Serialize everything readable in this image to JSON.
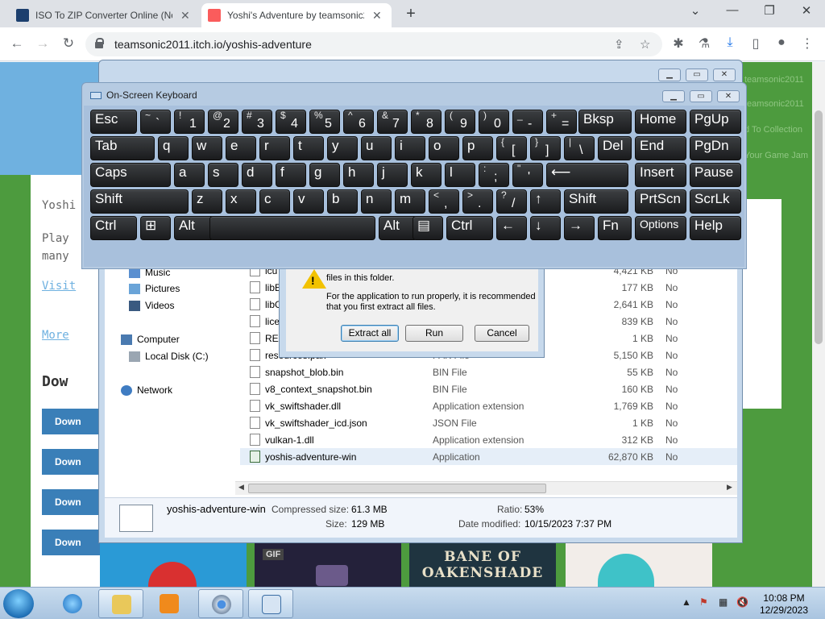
{
  "browser": {
    "tabs": [
      {
        "title": "ISO To ZIP Converter Online (No",
        "favicon": "ezyzip-icon",
        "active": false
      },
      {
        "title": "Yoshi's Adventure by teamsonic2",
        "favicon": "itchio-icon",
        "active": true
      }
    ],
    "url": "teamsonic2011.itch.io/yoshis-adventure"
  },
  "webpage": {
    "text_lines": [
      "Yoshi",
      "Play",
      "many",
      "Visit",
      "More",
      "Dow"
    ],
    "download_labels": [
      "Down",
      "Down",
      "Down",
      "Down"
    ],
    "right_links": [
      "teamsonic2011",
      "teamsonic2011",
      "d To Collection",
      "Your Game Jam"
    ],
    "gif_badge": "GIF",
    "thumb_text_1": "BANE OF",
    "thumb_text_2": "OAKENSHADE"
  },
  "osk": {
    "title": "On-Screen Keyboard",
    "rows": [
      [
        {
          "main": "Esc"
        },
        {
          "shift": "~",
          "main": "`"
        },
        {
          "shift": "!",
          "main": "1"
        },
        {
          "shift": "@",
          "main": "2"
        },
        {
          "shift": "#",
          "main": "3"
        },
        {
          "shift": "$",
          "main": "4"
        },
        {
          "shift": "%",
          "main": "5"
        },
        {
          "shift": "^",
          "main": "6"
        },
        {
          "shift": "&",
          "main": "7"
        },
        {
          "shift": "*",
          "main": "8"
        },
        {
          "shift": "(",
          "main": "9"
        },
        {
          "shift": ")",
          "main": "0"
        },
        {
          "shift": "_",
          "main": "-"
        },
        {
          "shift": "+",
          "main": "="
        },
        {
          "main": "Bksp"
        },
        {
          "main": "Home"
        },
        {
          "main": "PgUp"
        }
      ],
      [
        {
          "main": "Tab"
        },
        {
          "main": "q"
        },
        {
          "main": "w"
        },
        {
          "main": "e"
        },
        {
          "main": "r"
        },
        {
          "main": "t"
        },
        {
          "main": "y"
        },
        {
          "main": "u"
        },
        {
          "main": "i"
        },
        {
          "main": "o"
        },
        {
          "main": "p"
        },
        {
          "shift": "{",
          "main": "["
        },
        {
          "shift": "}",
          "main": "]"
        },
        {
          "shift": "|",
          "main": "\\"
        },
        {
          "main": "Del"
        },
        {
          "main": "End"
        },
        {
          "main": "PgDn"
        }
      ],
      [
        {
          "main": "Caps"
        },
        {
          "main": "a"
        },
        {
          "main": "s"
        },
        {
          "main": "d"
        },
        {
          "main": "f"
        },
        {
          "main": "g"
        },
        {
          "main": "h"
        },
        {
          "main": "j"
        },
        {
          "main": "k"
        },
        {
          "main": "l"
        },
        {
          "shift": ":",
          "main": ";"
        },
        {
          "shift": "\"",
          "main": "'"
        },
        {
          "main": "⟵"
        },
        {
          "main": "Insert"
        },
        {
          "main": "Pause"
        }
      ],
      [
        {
          "main": "Shift"
        },
        {
          "main": "z"
        },
        {
          "main": "x"
        },
        {
          "main": "c"
        },
        {
          "main": "v"
        },
        {
          "main": "b"
        },
        {
          "main": "n"
        },
        {
          "main": "m"
        },
        {
          "shift": "<",
          "main": ","
        },
        {
          "shift": ">",
          "main": "."
        },
        {
          "shift": "?",
          "main": "/"
        },
        {
          "main": "↑"
        },
        {
          "main": "Shift"
        },
        {
          "main": "PrtScn"
        },
        {
          "main": "ScrLk"
        }
      ],
      [
        {
          "main": "Ctrl"
        },
        {
          "main": "⊞"
        },
        {
          "main": "Alt"
        },
        {
          "main": ""
        },
        {
          "main": "Alt"
        },
        {
          "main": "▤"
        },
        {
          "main": "Ctrl"
        },
        {
          "main": "←"
        },
        {
          "main": "↓"
        },
        {
          "main": "→"
        },
        {
          "main": "Fn"
        },
        {
          "main": "Options"
        },
        {
          "main": "Help"
        }
      ]
    ]
  },
  "explorer": {
    "nav": [
      "Music",
      "Pictures",
      "Videos",
      "Computer",
      "Local Disk (C:)",
      "Network"
    ],
    "files": [
      {
        "name": "icu",
        "type": "",
        "size": "4,421 KB",
        "pw": "No"
      },
      {
        "name": "libE",
        "type": "",
        "size": "177 KB",
        "pw": "No"
      },
      {
        "name": "libG",
        "type": "",
        "size": "2,641 KB",
        "pw": "No"
      },
      {
        "name": "lice",
        "type": "",
        "size": "839 KB",
        "pw": "No"
      },
      {
        "name": "REA",
        "type": "",
        "size": "1 KB",
        "pw": "No"
      },
      {
        "name": "resources.pak",
        "type": "PAK File",
        "size": "5,150 KB",
        "pw": "No"
      },
      {
        "name": "snapshot_blob.bin",
        "type": "BIN File",
        "size": "55 KB",
        "pw": "No"
      },
      {
        "name": "v8_context_snapshot.bin",
        "type": "BIN File",
        "size": "160 KB",
        "pw": "No"
      },
      {
        "name": "vk_swiftshader.dll",
        "type": "Application extension",
        "size": "1,769 KB",
        "pw": "No"
      },
      {
        "name": "vk_swiftshader_icd.json",
        "type": "JSON File",
        "size": "1 KB",
        "pw": "No"
      },
      {
        "name": "vulkan-1.dll",
        "type": "Application extension",
        "size": "312 KB",
        "pw": "No"
      },
      {
        "name": "yoshis-adventure-win",
        "type": "Application",
        "size": "62,870 KB",
        "pw": "No"
      }
    ],
    "details": {
      "name": "yoshis-adventure-win",
      "compressed_label": "Compressed size:",
      "compressed": "61.3 MB",
      "size_label": "Size:",
      "size": "129 MB",
      "ratio_label": "Ratio:",
      "ratio": "53%",
      "date_label": "Date modified:",
      "date": "10/15/2023 7:37 PM"
    }
  },
  "dialog": {
    "line1": "files in this folder.",
    "line2": "For the application to run properly, it is recommended",
    "line3": "that you first extract all files.",
    "extract": "Extract all",
    "run": "Run",
    "cancel": "Cancel"
  },
  "taskbar": {
    "time": "10:08 PM",
    "date": "12/29/2023"
  }
}
